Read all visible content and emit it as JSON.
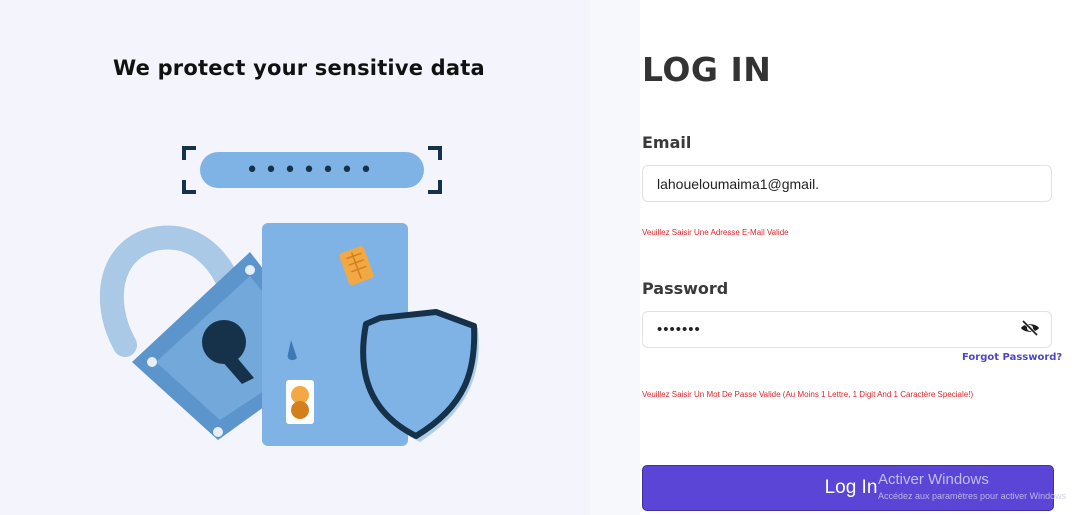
{
  "hero": {
    "title": "We protect your sensitive data"
  },
  "illustration": {
    "password_mask": "•••••••"
  },
  "login": {
    "title": "LOG IN",
    "email_label": "Email",
    "email_value": "lahoueloumaima1@gmail.",
    "email_error": "Veuillez Saisir Une Adresse E-Mail Valide",
    "password_label": "Password",
    "password_value": "•••••••",
    "forgot_password": "Forgot Password?",
    "password_error": "Veuillez Saisir Un Mot De Passe Valide (Au Moins 1 Lettre, 1 Digit And 1 Caractère Speciale!)",
    "submit_label": "Log In"
  },
  "watermark": {
    "title": "Activer Windows",
    "subtitle": "Accédez aux paramètres pour activer Windows"
  },
  "icons": {
    "password_toggle": "eye-slash-icon"
  },
  "colors": {
    "accent": "#5a45d6",
    "error": "#e0242b",
    "link": "#4f46c8",
    "illustration_blue": "#7fb2e5",
    "illustration_dark": "#16324a"
  }
}
